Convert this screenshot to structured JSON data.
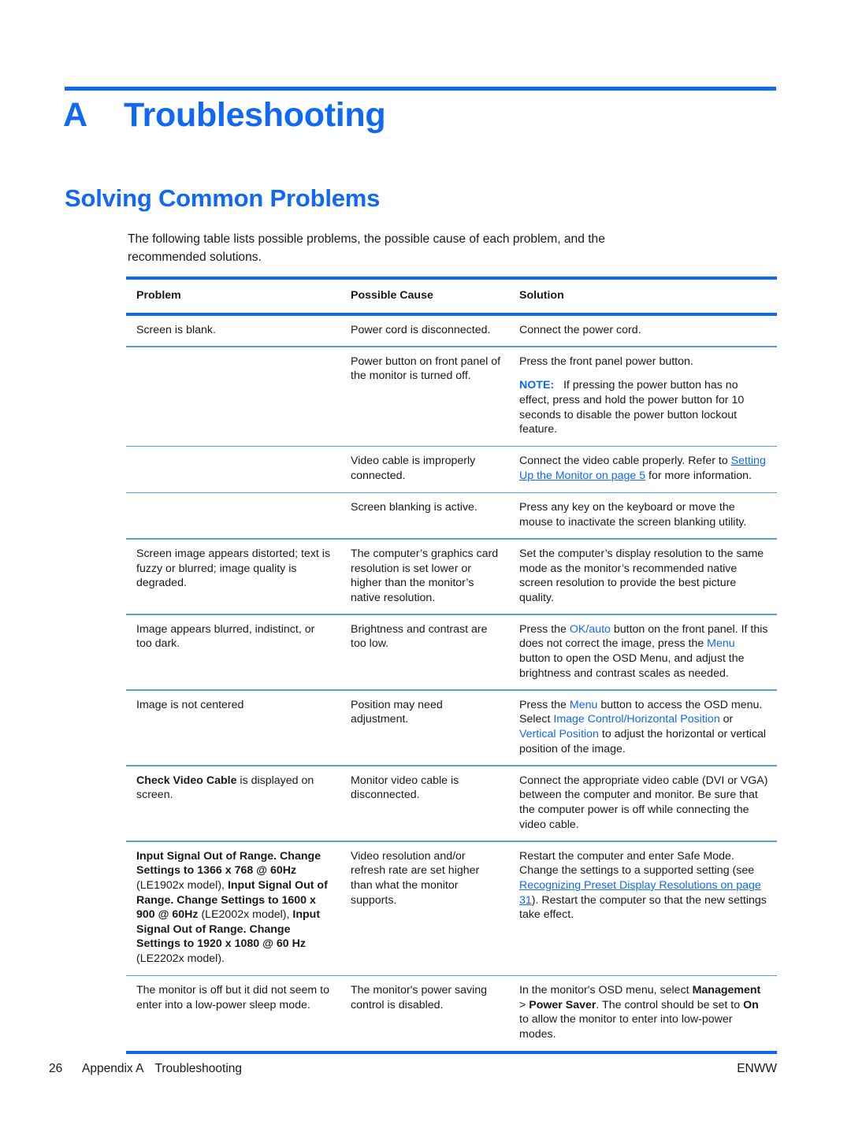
{
  "accent_color": "#1068f5",
  "chapter": {
    "letter": "A",
    "title": "Troubleshooting"
  },
  "section": {
    "title": "Solving Common Problems"
  },
  "intro": "The following table lists possible problems, the possible cause of each problem, and the recommended solutions.",
  "table": {
    "headers": {
      "problem": "Problem",
      "cause": "Possible Cause",
      "solution": "Solution"
    },
    "rows": [
      {
        "problem": "Screen is blank.",
        "cause": "Power cord is disconnected.",
        "solution": "Connect the power cord."
      },
      {
        "problem": "",
        "cause": "Power button on front panel of the monitor is turned off.",
        "solution_line1": "Press the front panel power button.",
        "note_label": "NOTE:",
        "note_text": "If pressing the power button has no effect, press and hold the power button for 10 seconds to disable the power button lockout feature."
      },
      {
        "problem": "",
        "cause": "Video cable is improperly connected.",
        "solution_pre": "Connect the video cable properly. Refer to ",
        "solution_link": "Setting Up the Monitor on page 5",
        "solution_post": " for more information."
      },
      {
        "problem": "",
        "cause": "Screen blanking is active.",
        "solution": "Press any key on the keyboard or move the mouse to inactivate the screen blanking utility."
      },
      {
        "problem": "Screen image appears distorted; text is fuzzy or blurred; image quality is degraded.",
        "cause": "The computer’s graphics card resolution is set lower or higher than the monitor’s native resolution.",
        "solution": "Set the computer’s display resolution to the same mode as the monitor’s recommended native screen resolution to provide the best picture quality."
      },
      {
        "problem": "Image appears blurred, indistinct, or too dark.",
        "cause": "Brightness and contrast are too low.",
        "solution_p1": "Press the ",
        "solution_ui1": "OK/auto",
        "solution_p2": " button on the front panel. If this does not correct the image, press the ",
        "solution_ui2": "Menu",
        "solution_p3": " button to open the OSD Menu, and adjust the brightness and contrast scales as needed."
      },
      {
        "problem": "Image is not centered",
        "cause": "Position may need adjustment.",
        "solution_p1": "Press the ",
        "solution_ui1": "Menu",
        "solution_p2": " button to access the OSD menu. Select ",
        "solution_ui2": "Image Control/Horizontal Position",
        "solution_p3": " or ",
        "solution_ui3": "Vertical Position",
        "solution_p4": " to adjust the horizontal or vertical position of the image."
      },
      {
        "problem_bold": "Check Video Cable",
        "problem_rest": " is displayed on screen.",
        "cause": "Monitor video cable is disconnected.",
        "solution": "Connect the appropriate video cable (DVI or VGA) between the computer and monitor. Be sure that the computer power is off while connecting the video cable."
      },
      {
        "problem_b1": "Input Signal Out of Range. Change Settings to 1366 x 768 @ 60Hz",
        "problem_r1": " (LE1902x model), ",
        "problem_b2": "Input Signal Out of Range. Change Settings to 1600 x 900 @ 60Hz",
        "problem_r2": " (LE2002x model), ",
        "problem_b3": "Input Signal Out of Range. Change Settings to 1920 x 1080 @ 60 Hz",
        "problem_r3": " (LE2202x model).",
        "cause": "Video resolution and/or refresh rate are set higher than what the monitor supports.",
        "solution_pre": "Restart the computer and enter Safe Mode. Change the settings to a supported setting (see ",
        "solution_link": "Recognizing Preset Display Resolutions on page 31",
        "solution_post": "). Restart the computer so that the new settings take effect."
      },
      {
        "problem": "The monitor is off but it did not seem to enter into a low-power sleep mode.",
        "cause": "The monitor's power saving control is disabled.",
        "solution_p1": "In the monitor's OSD menu, select ",
        "solution_b1": "Management",
        "solution_p2": " > ",
        "solution_b2": "Power Saver",
        "solution_p3": ". The control should be set to ",
        "solution_b3": "On",
        "solution_p4": " to allow the monitor to enter into low-power modes."
      }
    ]
  },
  "footer": {
    "page_number": "26",
    "appendix_label": "Appendix A",
    "chapter_name": "Troubleshooting",
    "right": "ENWW"
  }
}
